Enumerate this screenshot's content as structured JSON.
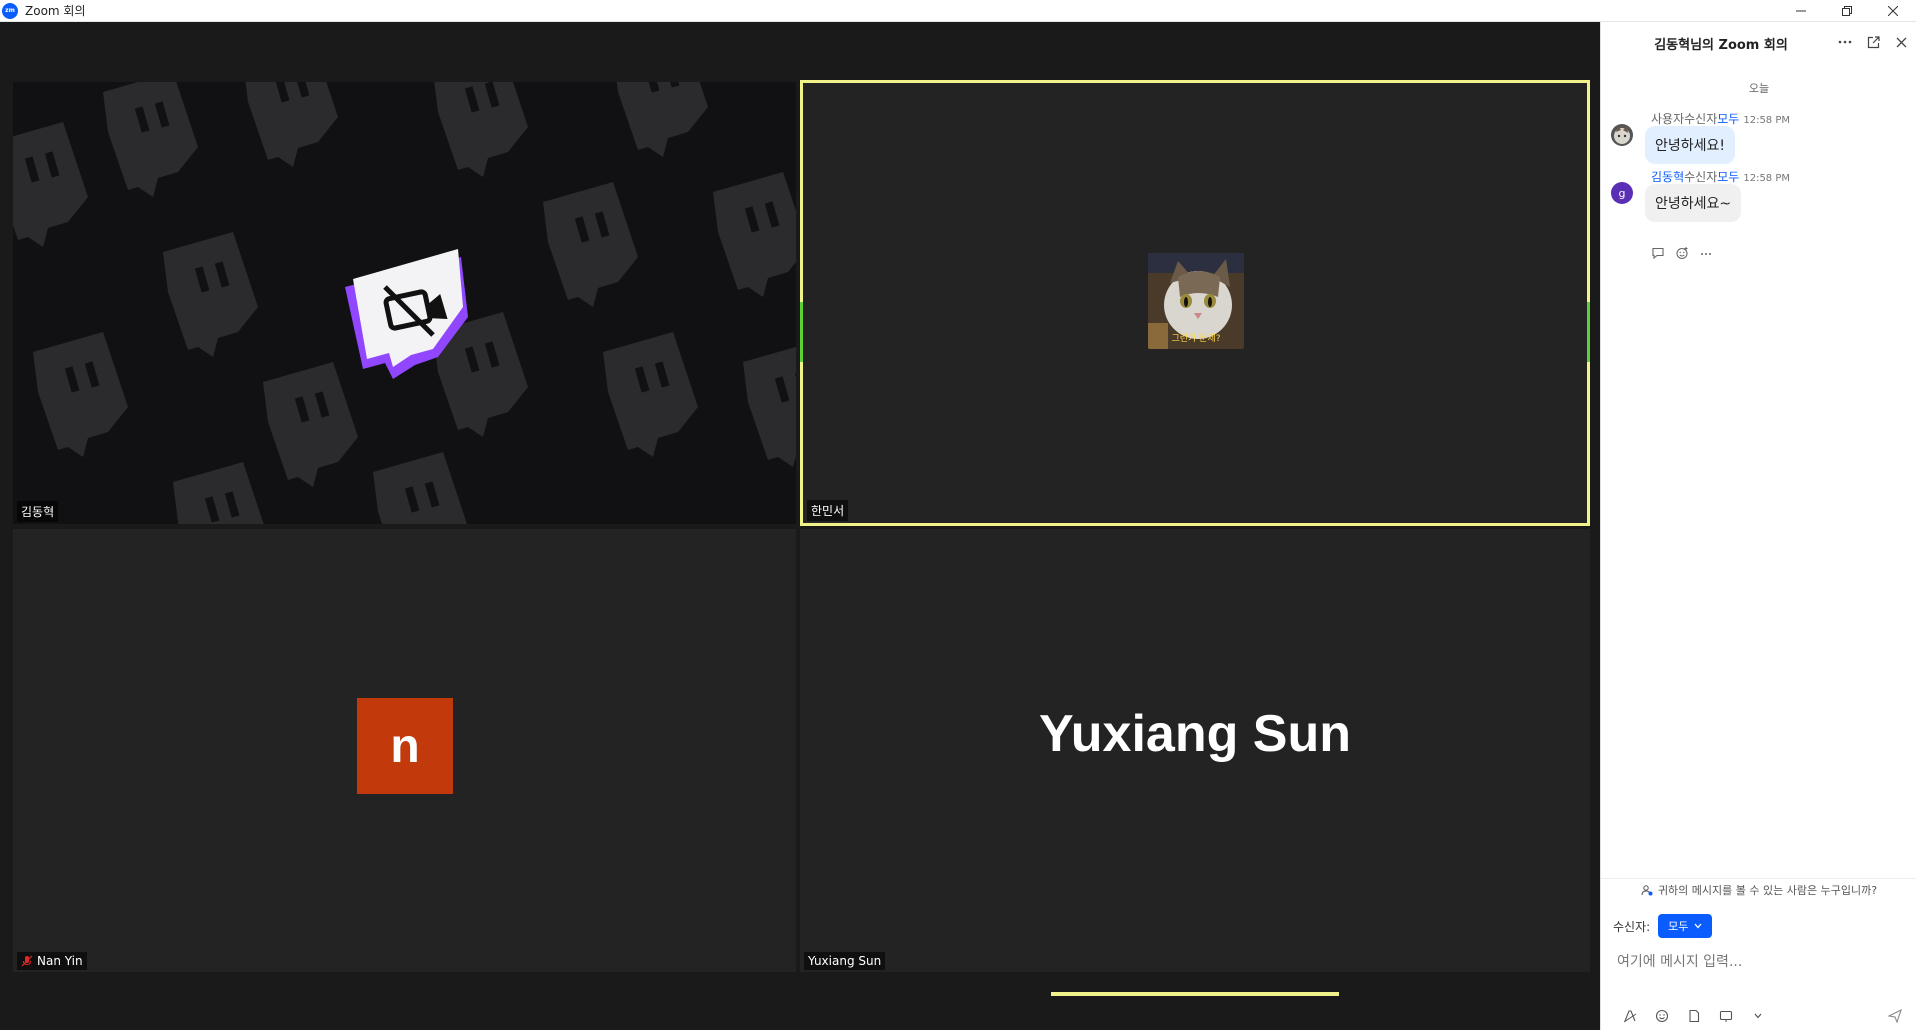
{
  "window": {
    "title": "Zoom 회의",
    "logo_text": "zm"
  },
  "participants": [
    {
      "name": "김동혁",
      "state": "video-off"
    },
    {
      "name": "한민서",
      "state": "avatar-photo",
      "active_speaker": true
    },
    {
      "name": "Nan Yin",
      "state": "initial",
      "initial": "n",
      "muted": true,
      "initial_color": "#c23a0c"
    },
    {
      "name": "Yuxiang Sun",
      "state": "name-only",
      "display_name": "Yuxiang Sun"
    }
  ],
  "chat": {
    "title": "김동혁님의 Zoom 회의",
    "date_divider": "오늘",
    "messages": [
      {
        "sender": "사용자",
        "to_label": "수신자",
        "to": "모두",
        "time": "12:58 PM",
        "text": "안녕하세요!"
      },
      {
        "sender": "김동혁",
        "to_label": "수신자",
        "to": "모두",
        "time": "12:58 PM",
        "text": "안녕하세요~",
        "avatar_letter": "g"
      }
    ],
    "privacy_hint": "귀하의 메시지를 볼 수 있는 사람은 누구입니까?",
    "recipient_label": "수신자:",
    "recipient_value": "모두",
    "input_placeholder": "여기에 메시지 입력..."
  },
  "colors": {
    "zoom_blue": "#0b5cff",
    "active_speaker": "#f2f28a",
    "twitch_purple": "#9146ff"
  }
}
